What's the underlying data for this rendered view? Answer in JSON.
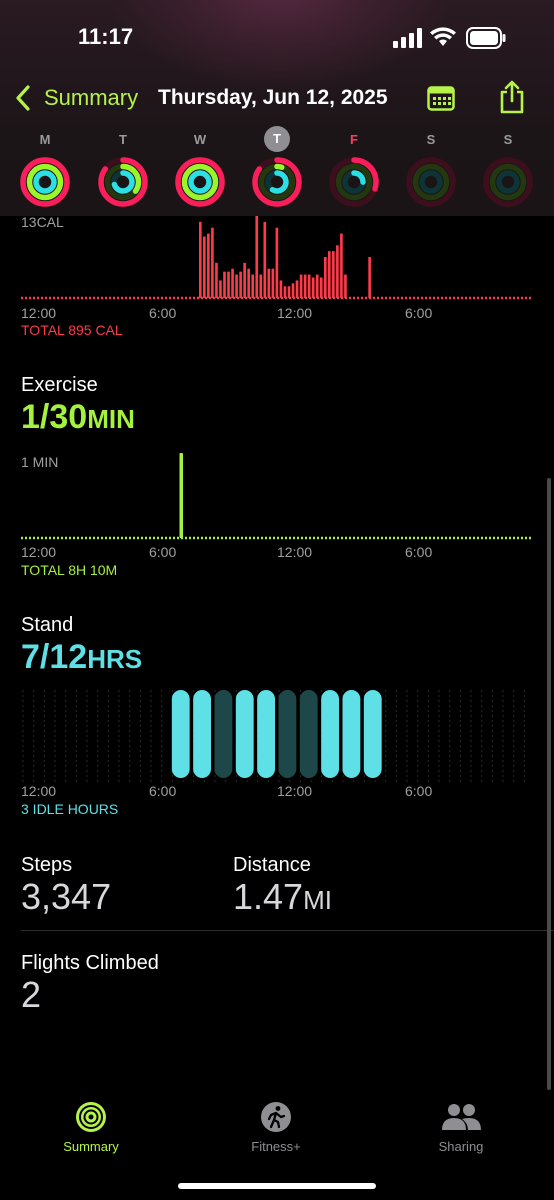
{
  "status_bar": {
    "time": "11:17"
  },
  "nav": {
    "back_label": "Summary",
    "title": "Thursday, Jun 12, 2025"
  },
  "week": [
    {
      "letter": "M",
      "move": 1.0,
      "exercise": 1.0,
      "stand": 1.0,
      "state": "normal"
    },
    {
      "letter": "T",
      "move": 0.85,
      "exercise": 0.35,
      "stand": 0.7,
      "state": "normal"
    },
    {
      "letter": "W",
      "move": 1.0,
      "exercise": 1.0,
      "stand": 1.0,
      "state": "normal"
    },
    {
      "letter": "T",
      "move": 0.85,
      "exercise": 0.05,
      "stand": 0.58,
      "state": "today"
    },
    {
      "letter": "F",
      "move": 0.3,
      "exercise": 0.0,
      "stand": 0.25,
      "state": "fri"
    },
    {
      "letter": "S",
      "move": 0.0,
      "exercise": 0.0,
      "stand": 0.0,
      "state": "normal"
    },
    {
      "letter": "S",
      "move": 0.0,
      "exercise": 0.0,
      "stand": 0.0,
      "state": "normal"
    }
  ],
  "move": {
    "max_label": "13CAL",
    "total": "TOTAL 895 CAL",
    "color": "#ff3b4a",
    "bars": [
      0,
      0,
      0,
      0,
      0,
      0,
      0,
      0,
      0,
      0,
      0,
      0,
      0,
      0,
      0,
      0,
      0,
      0,
      0,
      0,
      0,
      0,
      0,
      0,
      0,
      0,
      0,
      0,
      0,
      0,
      0,
      0,
      0,
      0,
      0,
      0,
      0,
      0,
      0,
      0,
      0,
      0,
      0,
      0,
      13,
      10.5,
      11,
      12,
      6,
      3,
      4.5,
      4.5,
      5,
      4,
      4.5,
      6,
      5,
      4,
      14,
      4,
      13,
      5,
      5,
      12,
      3,
      2,
      2,
      2.5,
      3,
      4,
      4,
      4,
      3.5,
      4,
      3.5,
      7,
      8,
      8,
      9,
      11,
      4,
      0,
      0,
      0,
      0,
      0,
      7,
      0,
      0,
      0,
      0,
      0,
      0,
      0,
      0,
      0,
      0,
      0,
      0,
      0,
      0,
      0,
      0,
      0,
      0,
      0,
      0,
      0,
      0,
      0,
      0,
      0,
      0,
      0,
      0,
      0,
      0,
      0,
      0,
      0,
      0,
      0,
      0,
      0,
      0,
      0,
      0
    ]
  },
  "exercise": {
    "title": "Exercise",
    "value": "1/30",
    "unit": "MIN",
    "max_label": "1 MIN",
    "total": "TOTAL 8H 10M",
    "color": "#a4f23d",
    "spike_hour": 7.5
  },
  "stand": {
    "title": "Stand",
    "value": "7/12",
    "unit": "HRS",
    "idle": "3 IDLE HOURS",
    "color": "#5ee0e6",
    "hours": [
      0,
      0,
      0,
      0,
      0,
      0,
      0,
      1,
      1,
      0,
      1,
      1,
      0,
      0,
      1,
      1,
      1,
      0,
      0,
      0,
      0,
      0,
      0,
      0
    ]
  },
  "axis_labels": [
    "12:00",
    "6:00",
    "12:00",
    "6:00"
  ],
  "steps": {
    "title": "Steps",
    "value": "3,347"
  },
  "distance": {
    "title": "Distance",
    "value": "1.47",
    "unit": "MI"
  },
  "flights": {
    "title": "Flights Climbed",
    "value": "2"
  },
  "tabs": [
    {
      "label": "Summary",
      "icon": "activity-rings-icon",
      "active": true
    },
    {
      "label": "Fitness+",
      "icon": "runner-icon",
      "active": false
    },
    {
      "label": "Sharing",
      "icon": "people-icon",
      "active": false
    }
  ],
  "colors": {
    "accent": "#b5f24a",
    "move": "#ff3b4a",
    "exercise": "#a4f23d",
    "stand": "#5ee0e6"
  }
}
